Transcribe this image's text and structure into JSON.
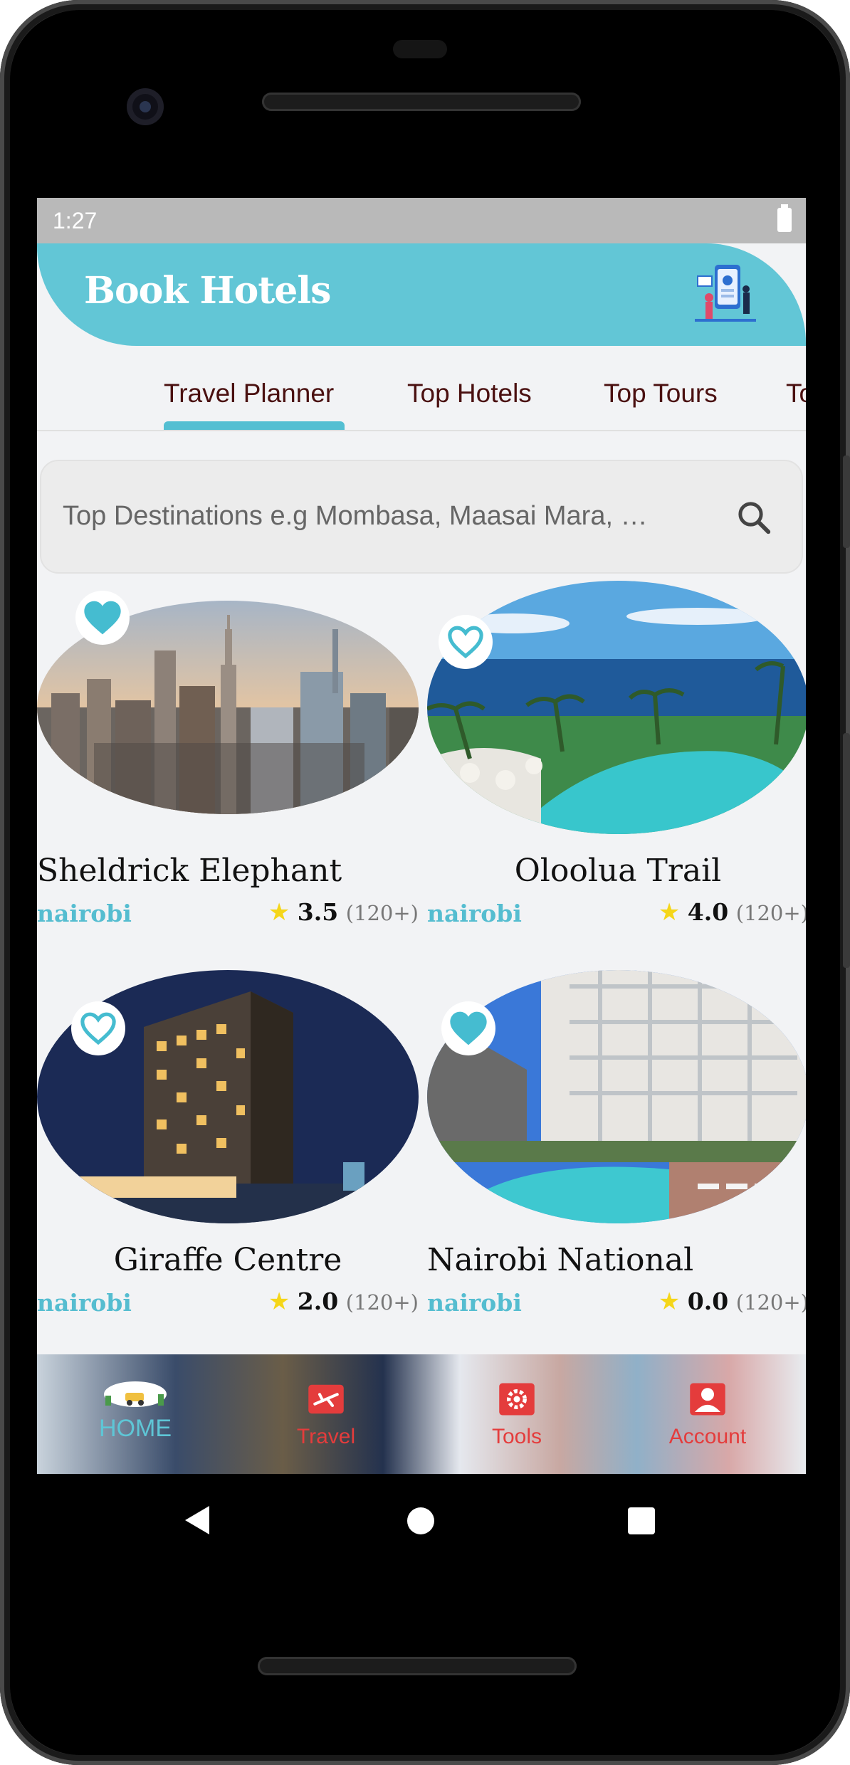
{
  "status_bar": {
    "time": "1:27"
  },
  "header": {
    "title": "Book Hotels",
    "illustration_icon": "hotel-booking-illustration"
  },
  "tabs": [
    {
      "label": "Travel Planner",
      "selected": true
    },
    {
      "label": "Top Hotels",
      "selected": false
    },
    {
      "label": "Top Tours",
      "selected": false
    },
    {
      "label": "To",
      "selected": false
    }
  ],
  "search": {
    "placeholder": "Top Destinations e.g Mombasa, Maasai Mara, …",
    "icon": "search-icon"
  },
  "destinations": [
    {
      "title": "Sheldrick Elephant",
      "city": "nairobi",
      "rating": "3.5",
      "count": "(120+)",
      "favorite": true,
      "image": "city-skyline"
    },
    {
      "title": "Oloolua Trail",
      "city": "nairobi",
      "rating": "4.0",
      "count": "(120+)",
      "favorite": false,
      "image": "resort-pool-ocean"
    },
    {
      "title": "Giraffe Centre",
      "city": "nairobi",
      "rating": "2.0",
      "count": "(120+)",
      "favorite": false,
      "image": "hotel-tower-night"
    },
    {
      "title": "Nairobi National",
      "city": "nairobi",
      "rating": "0.0",
      "count": "(120+)",
      "favorite": true,
      "image": "hotel-pool-balconies"
    }
  ],
  "bottom_nav": [
    {
      "label": "HOME",
      "icon": "home-illustration-icon",
      "active": true
    },
    {
      "label": "Travel",
      "icon": "plane-ticket-icon",
      "active": false
    },
    {
      "label": "Tools",
      "icon": "gear-icon",
      "active": false
    },
    {
      "label": "Account",
      "icon": "account-icon",
      "active": false
    }
  ],
  "colors": {
    "accent": "#62c6d6",
    "tab_text": "#4a1010",
    "nav_red": "#e43c3c",
    "star": "#f5d619"
  }
}
